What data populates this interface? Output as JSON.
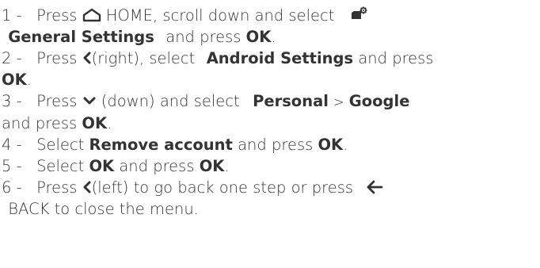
{
  "colors": {
    "text": "#333333",
    "background": "#ffffff"
  },
  "steps": [
    {
      "num": "1 -",
      "t1": "Press",
      "icon1": "home-icon",
      "t2": "HOME, scroll down and select",
      "icon2": "settings-icon",
      "b1": "General Settings",
      "t3": "and press",
      "b2": "OK",
      "t4": "."
    },
    {
      "num": "2 -",
      "t1": "Press",
      "icon1": "chevron-left-icon",
      "t2": "(right), select",
      "b1": "Android Settings",
      "t3": "and press",
      "b2": "OK",
      "t4": "."
    },
    {
      "num": "3 -",
      "t1": "Press",
      "icon1": "chevron-down-icon",
      "t2": "(down) and select",
      "b1": "Personal",
      "t3": ">",
      "b2": "Google",
      "t4": "and press",
      "b3": "OK",
      "t5": "."
    },
    {
      "num": "4 -",
      "t1": "Select",
      "b1": "Remove account",
      "t2": "and press",
      "b2": "OK",
      "t3": "."
    },
    {
      "num": "5 -",
      "t1": "Select",
      "b1": "OK",
      "t2": "and press",
      "b2": "OK",
      "t3": "."
    },
    {
      "num": "6 -",
      "t1": "Press",
      "icon1": "chevron-left-icon",
      "t2": "(left) to go back one step or press",
      "icon2": "back-arrow-icon",
      "t3": "BACK to close the menu."
    }
  ]
}
